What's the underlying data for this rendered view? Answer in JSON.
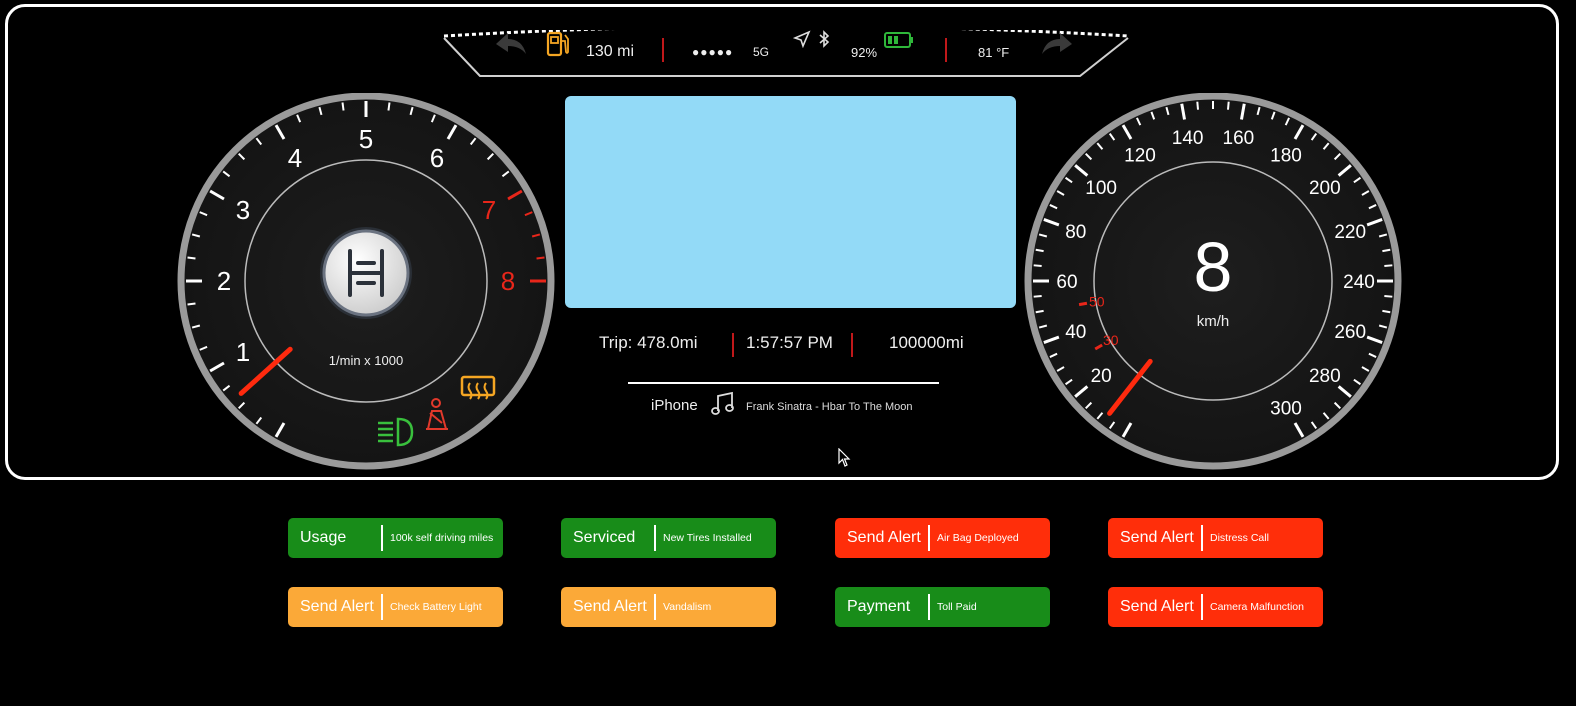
{
  "topbar": {
    "range": "130 mi",
    "signal_dots": "●●●●●",
    "network": "5G",
    "battery": "92%",
    "temperature": "81 °F",
    "icons": [
      "back-arrow-icon",
      "fuel-pump-icon",
      "navigation-icon",
      "bluetooth-icon",
      "battery-icon",
      "forward-arrow-icon"
    ]
  },
  "tachometer": {
    "labels": [
      "1",
      "2",
      "3",
      "4",
      "5",
      "6",
      "7",
      "8"
    ],
    "unit": "1/min x 1000",
    "needle_value": 0.6,
    "redline_start": 7,
    "gear_icon": "gear-shift-icon",
    "indicators": [
      "headlight-icon",
      "seatbelt-icon",
      "rear-defrost-icon"
    ],
    "colors": {
      "redline": "#e8261a",
      "needle": "#ff2a0e"
    }
  },
  "speedometer": {
    "labels": [
      "20",
      "30",
      "40",
      "50",
      "60",
      "80",
      "100",
      "120",
      "140",
      "160",
      "180",
      "200",
      "220",
      "240",
      "260",
      "280",
      "300"
    ],
    "speed": "8",
    "unit": "km/h",
    "needle_value": 8
  },
  "trip": {
    "trip": "Trip: 478.0mi",
    "time": "1:57:57 PM",
    "odometer": "100000mi"
  },
  "media": {
    "source": "iPhone",
    "track": "Frank Sinatra - Hbar To The Moon",
    "icon": "music-note-icon"
  },
  "buttons": [
    {
      "main": "Usage",
      "sub": "100k self driving miles",
      "color": "green"
    },
    {
      "main": "Serviced",
      "sub": "New Tires Installed",
      "color": "green"
    },
    {
      "main": "Send Alert",
      "sub": "Air Bag Deployed",
      "color": "red"
    },
    {
      "main": "Send Alert",
      "sub": "Distress Call",
      "color": "red"
    },
    {
      "main": "Send Alert",
      "sub": "Check Battery Light",
      "color": "orange"
    },
    {
      "main": "Send Alert",
      "sub": "Vandalism",
      "color": "orange"
    },
    {
      "main": "Payment",
      "sub": "Toll Paid",
      "color": "green"
    },
    {
      "main": "Send Alert",
      "sub": "Camera Malfunction",
      "color": "red"
    }
  ]
}
